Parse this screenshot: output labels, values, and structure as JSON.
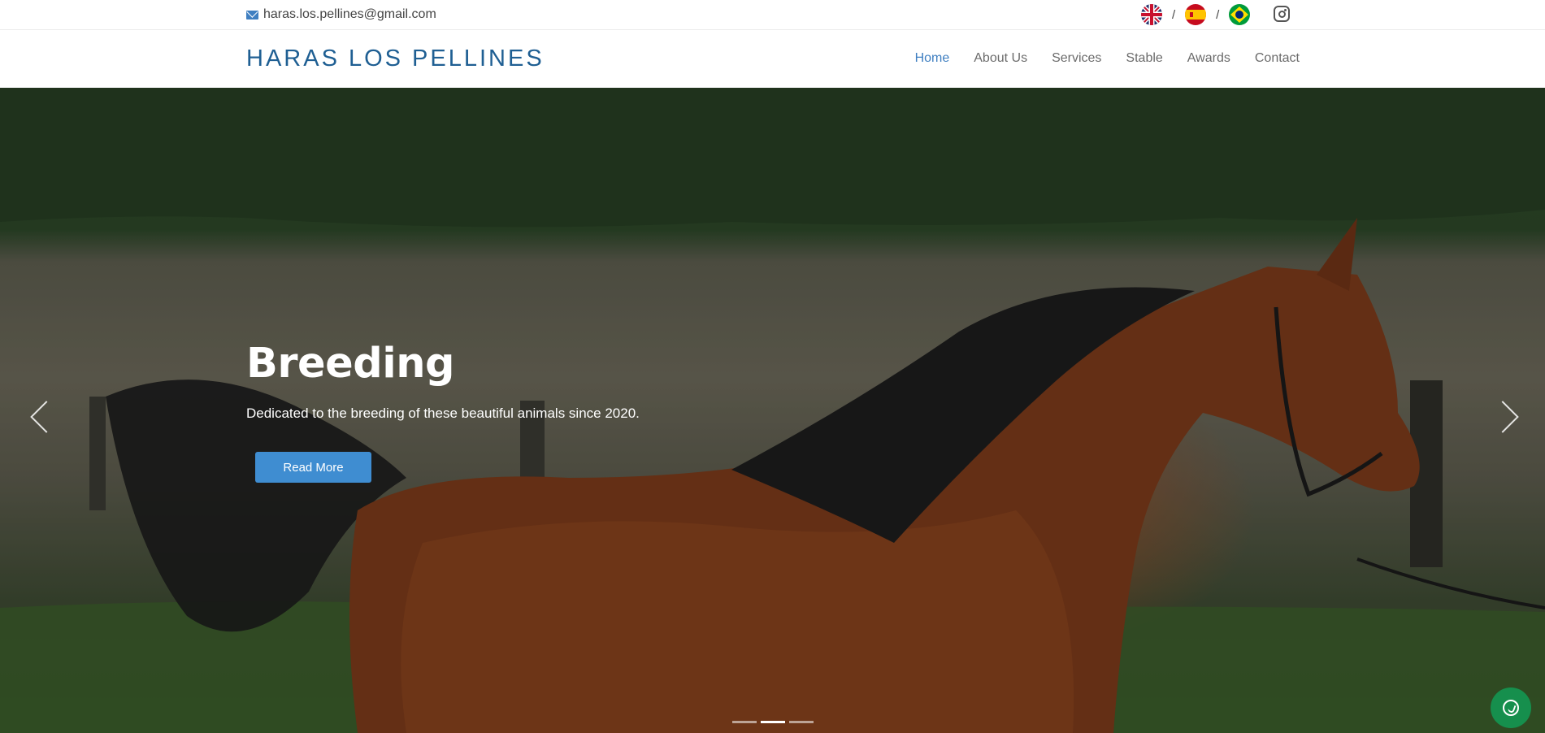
{
  "topbar": {
    "email": "haras.los.pellines@gmail.com",
    "languages": [
      {
        "icon": "uk-flag-icon"
      },
      {
        "icon": "spain-flag-icon"
      },
      {
        "icon": "brazil-flag-icon"
      }
    ],
    "separator": "/",
    "social_icon": "instagram-icon"
  },
  "navbar": {
    "brand": "HARAS LOS PELLINES",
    "menu": [
      {
        "label": "Home",
        "active": true
      },
      {
        "label": "About Us"
      },
      {
        "label": "Services"
      },
      {
        "label": "Stable"
      },
      {
        "label": "Awards"
      },
      {
        "label": "Contact"
      }
    ]
  },
  "hero": {
    "title": "Breeding",
    "subtitle": "Dedicated to the breeding of these beautiful animals since 2020.",
    "button_label": "Read More",
    "slides_total": 3,
    "active_slide": 2
  },
  "colors": {
    "brand": "#1f5f93",
    "accent": "#3f8dd1",
    "active_link": "#3f7fc1",
    "whatsapp": "#168f4d"
  }
}
